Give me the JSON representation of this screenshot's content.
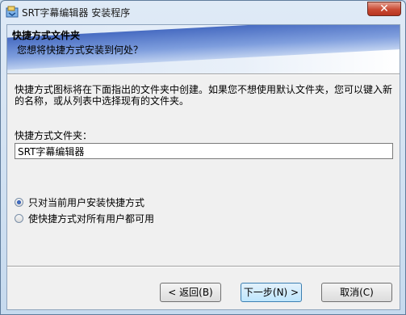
{
  "window": {
    "title": "SRT字幕编辑器 安装程序",
    "close_label": "✕",
    "accent": "#c94a33"
  },
  "header": {
    "title": "快捷方式文件夹",
    "subtitle": "您想将快捷方式安装到何处？"
  },
  "body": {
    "description": "快捷方式图标将在下面指出的文件夹中创建。如果您不想使用默认文件夹，您可以键入新的名称，或从列表中选择现有的文件夹。",
    "folder_label": "快捷方式文件夹：",
    "folder_value": "SRT字幕编辑器"
  },
  "options": [
    {
      "label": "只对当前用户安装快捷方式",
      "checked": true
    },
    {
      "label": "使快捷方式对所有用户都可用",
      "checked": false
    }
  ],
  "buttons": {
    "back": "< 返回(B)",
    "next": "下一步(N) >",
    "cancel": "取消(C)"
  }
}
